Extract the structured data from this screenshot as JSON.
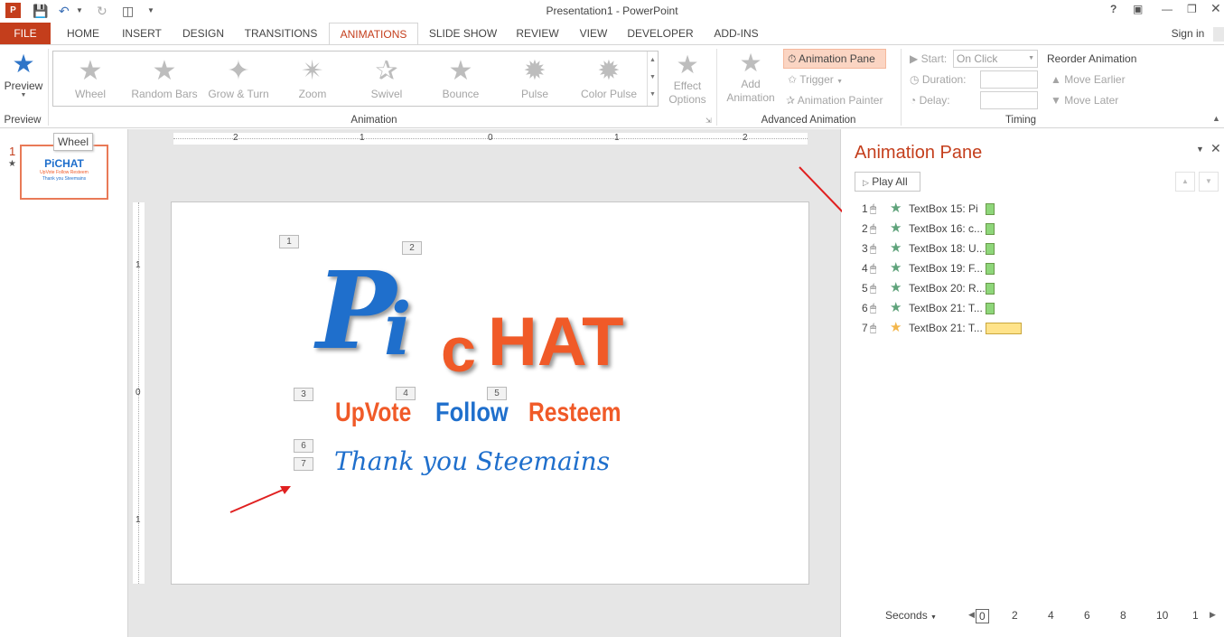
{
  "window": {
    "title": "Presentation1 - PowerPoint",
    "help": "?",
    "sign_in": "Sign in"
  },
  "tabs": [
    "FILE",
    "HOME",
    "INSERT",
    "DESIGN",
    "TRANSITIONS",
    "ANIMATIONS",
    "SLIDE SHOW",
    "REVIEW",
    "VIEW",
    "DEVELOPER",
    "ADD-INS"
  ],
  "ribbon": {
    "preview": {
      "label": "Preview",
      "group": "Preview"
    },
    "animation_group": "Animation",
    "effects": [
      "Wheel",
      "Random Bars",
      "Grow & Turn",
      "Zoom",
      "Swivel",
      "Bounce",
      "Pulse",
      "Color Pulse"
    ],
    "effect_options": [
      "Effect",
      "Options"
    ],
    "add_animation": [
      "Add",
      "Animation"
    ],
    "animation_pane_btn": "Animation Pane",
    "trigger": "Trigger",
    "animation_painter": "Animation Painter",
    "advanced_group": "Advanced Animation",
    "start_label": "Start:",
    "start_value": "On Click",
    "duration_label": "Duration:",
    "delay_label": "Delay:",
    "timing_group": "Timing",
    "reorder_title": "Reorder Animation",
    "move_earlier": "Move Earlier",
    "move_later": "Move Later"
  },
  "tooltip": "Wheel",
  "thumbnail": {
    "number": "1",
    "star": "★",
    "brand": "PiCHAT",
    "sub1": "UpVote Follow Resteem",
    "sub2": "Thank you Steemains"
  },
  "rulers": {
    "h": [
      "2",
      "1",
      "0",
      "1",
      "2"
    ],
    "v": [
      "1",
      "0",
      "1"
    ]
  },
  "slide": {
    "logo_p": "P",
    "logo_i": "i",
    "logo_c": "c",
    "logo_hat": "HAT",
    "upvote": "UpVote",
    "follow": "Follow",
    "resteem": "Resteem",
    "thanks": "Thank you Steemains",
    "tags": [
      "1",
      "2",
      "3",
      "4",
      "5",
      "6",
      "7"
    ]
  },
  "animation_pane": {
    "title": "Animation Pane",
    "play_all": "Play All",
    "items": [
      {
        "num": "1",
        "label": "TextBox 15: Pi",
        "star_color": "#5fa37b",
        "bar_color": "#8ed67a"
      },
      {
        "num": "2",
        "label": "TextBox 16: c...",
        "star_color": "#5fa37b",
        "bar_color": "#8ed67a"
      },
      {
        "num": "3",
        "label": "TextBox 18: U...",
        "star_color": "#5fa37b",
        "bar_color": "#8ed67a"
      },
      {
        "num": "4",
        "label": "TextBox 19: F...",
        "star_color": "#5fa37b",
        "bar_color": "#8ed67a"
      },
      {
        "num": "5",
        "label": "TextBox 20: R...",
        "star_color": "#5fa37b",
        "bar_color": "#8ed67a"
      },
      {
        "num": "6",
        "label": "TextBox 21: T...",
        "star_color": "#5fa37b",
        "bar_color": "#8ed67a"
      },
      {
        "num": "7",
        "label": "TextBox 21: T...",
        "star_color": "#f3b64b",
        "bar_color": "#ffe38a"
      }
    ],
    "seconds": "Seconds",
    "timeline": [
      "0",
      "2",
      "4",
      "6",
      "8",
      "10",
      "1"
    ]
  },
  "colors": {
    "accent": "#c43e1c",
    "blue": "#1f6fcc",
    "orange": "#f05a28"
  }
}
